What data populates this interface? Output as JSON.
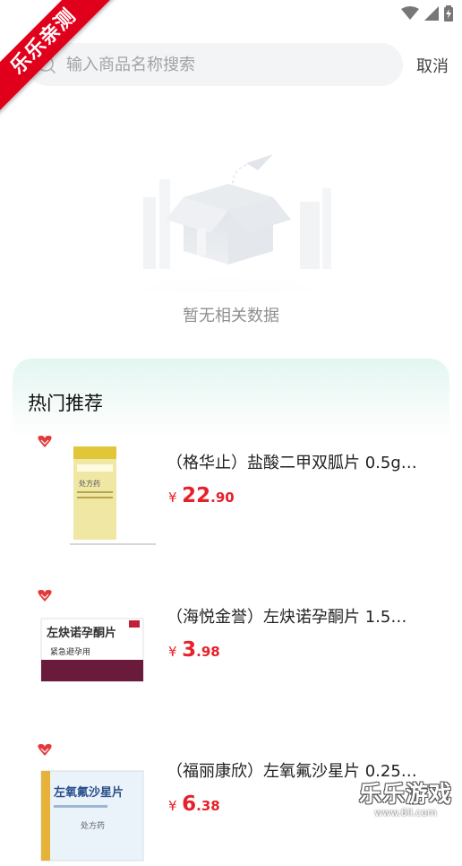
{
  "watermark": {
    "ribbon_text": "乐乐亲测",
    "corner_title": "乐乐游戏",
    "corner_url": "www.6ll.com"
  },
  "search": {
    "placeholder": "输入商品名称搜索",
    "value": "",
    "cancel_label": "取消"
  },
  "empty_state": {
    "message": "暂无相关数据"
  },
  "hot": {
    "title": "热门推荐",
    "products": [
      {
        "name": "（格华止）盐酸二甲双胍片 0.5g…",
        "currency": "¥",
        "price_int": "22",
        "price_dec": ".90",
        "image_text": "处方药"
      },
      {
        "name": "（海悦金誉）左炔诺孕酮片 1.5…",
        "currency": "¥",
        "price_int": "3",
        "price_dec": ".98",
        "image_text": "左炔诺孕酮片",
        "image_subtext": "紧急避孕用"
      },
      {
        "name": "（福丽康欣）左氧氟沙星片 0.25…",
        "currency": "¥",
        "price_int": "6",
        "price_dec": ".38",
        "image_text": "左氧氟沙星片",
        "image_subtext": "处方药"
      }
    ]
  },
  "colors": {
    "accent_price": "#e8202a",
    "card_gradient_top": "#e3f6f1",
    "search_bg": "#f3f4f6",
    "ribbon": "#e0001b"
  },
  "icons": [
    "wifi-icon",
    "signal-icon",
    "battery-charging-icon",
    "search-icon",
    "empty-box-icon",
    "pharmacy-logo-icon"
  ]
}
